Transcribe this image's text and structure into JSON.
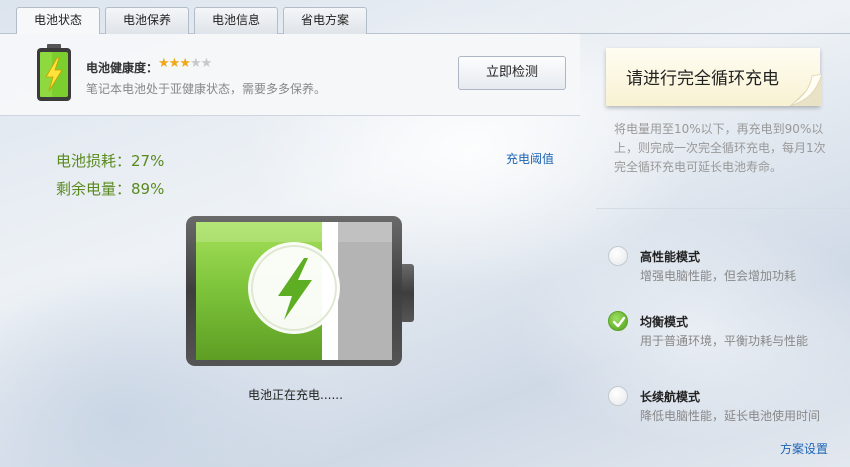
{
  "tabs": [
    {
      "label": "电池状态",
      "active": true
    },
    {
      "label": "电池保养",
      "active": false
    },
    {
      "label": "电池信息",
      "active": false
    },
    {
      "label": "省电方案",
      "active": false
    }
  ],
  "health": {
    "label": "电池健康度：",
    "rating": 3,
    "max_rating": 5,
    "description": "笔记本电池处于亚健康状态，需要多多保养。",
    "detect_button": "立即检测"
  },
  "stats": {
    "loss": "电池损耗：27%",
    "remaining": "剩余电量：89%",
    "remaining_fraction": 0.89,
    "threshold_link": "充电阈值"
  },
  "battery": {
    "status_text": "电池正在充电......",
    "fill_color": "#7cc33a",
    "icon": "lightning-bolt-icon"
  },
  "tip": {
    "title": "请进行完全循环充电",
    "text": "将电量用至10%以下，再充电到90%以上，则完成一次完全循环充电，每月1次完全循环充电可延长电池寿命。"
  },
  "modes": [
    {
      "title": "高性能模式",
      "description": "增强电脑性能，但会增加功耗",
      "selected": false
    },
    {
      "title": "均衡模式",
      "description": "用于普通环境，平衡功耗与性能",
      "selected": true
    },
    {
      "title": "长续航模式",
      "description": "降低电脑性能，延长电池使用时间",
      "selected": false
    }
  ],
  "scheme_link": "方案设置",
  "colors": {
    "accent_green": "#5a8a1e",
    "link_blue": "#1e64b4",
    "star": "#f0a818"
  }
}
